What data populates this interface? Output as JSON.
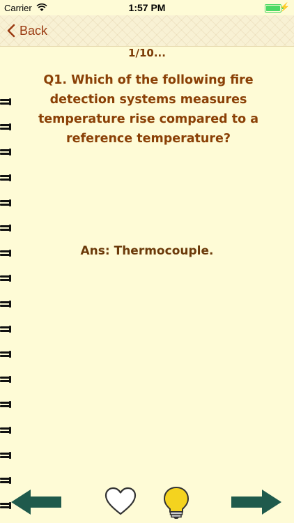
{
  "status_bar": {
    "carrier": "Carrier",
    "time": "1:57 PM"
  },
  "nav": {
    "back_label": "Back"
  },
  "card": {
    "counter": "1/10...",
    "question": "Q1. Which of the following fire detection systems measures temperature rise compared to a reference temperature?",
    "answer": "Ans:  Thermocouple."
  },
  "colors": {
    "background": "#fefbd6",
    "text_brown": "#8a4006",
    "arrow_green": "#1f5a4c",
    "bulb_yellow": "#f4d31f"
  },
  "icons": {
    "back": "chevron-left-icon",
    "previous": "arrow-left-icon",
    "favorite": "heart-outline-icon",
    "hint": "lightbulb-icon",
    "next": "arrow-right-icon"
  }
}
